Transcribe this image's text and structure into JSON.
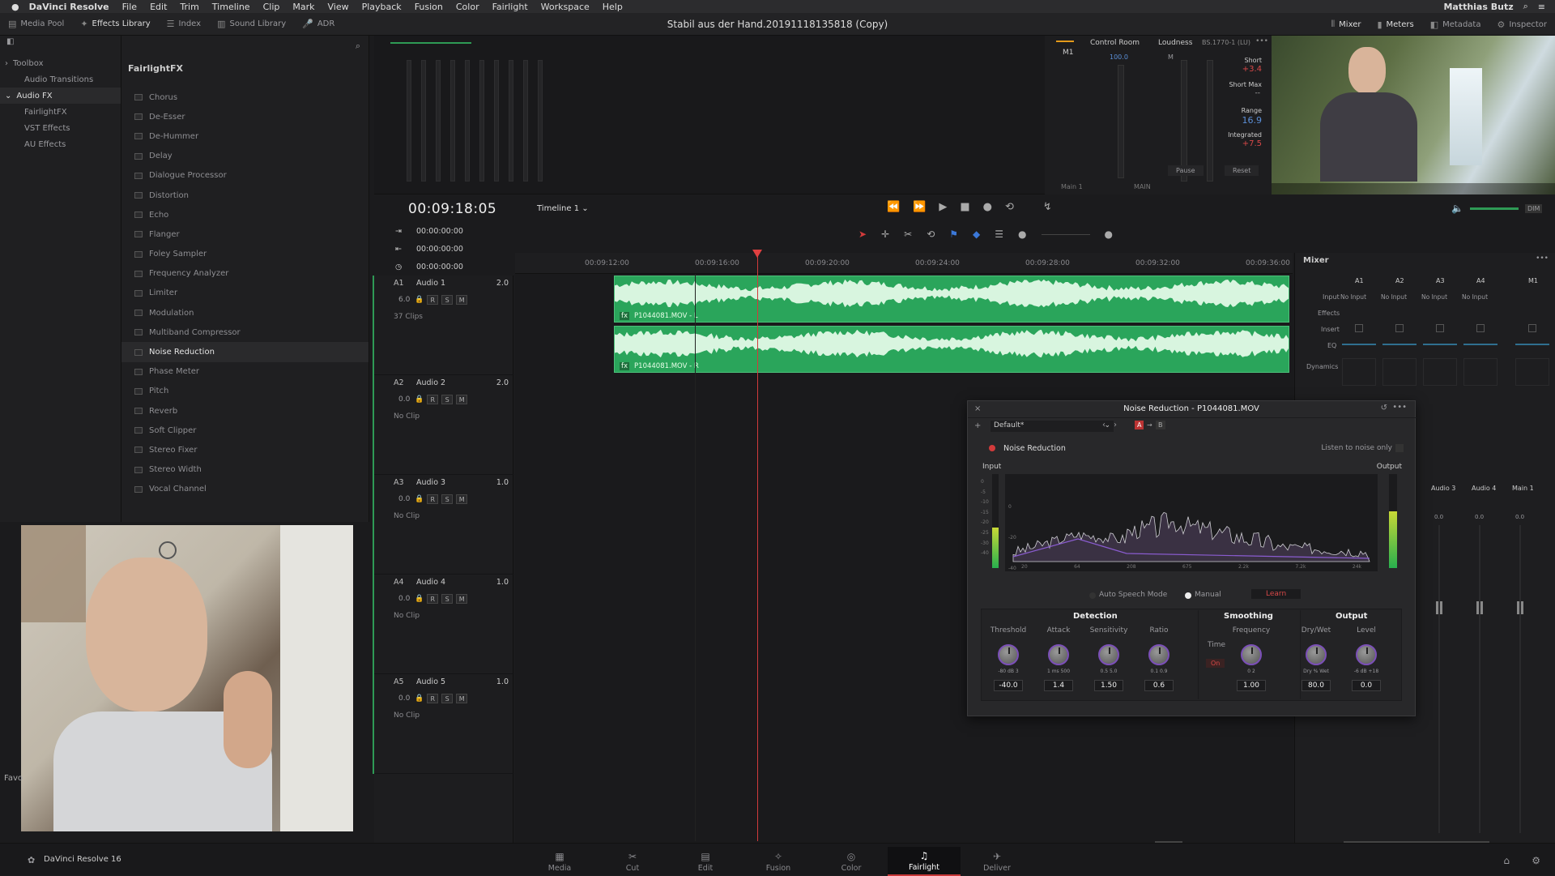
{
  "menubar": {
    "app_name": "DaVinci Resolve",
    "items": [
      "File",
      "Edit",
      "Trim",
      "Timeline",
      "Clip",
      "Mark",
      "View",
      "Playback",
      "Fusion",
      "Color",
      "Fairlight",
      "Workspace",
      "Help"
    ],
    "user": "Matthias Butz"
  },
  "toolbar": {
    "left": [
      {
        "icon": "media-pool-icon",
        "label": "Media Pool"
      },
      {
        "icon": "effects-library-icon",
        "label": "Effects Library"
      },
      {
        "icon": "index-icon",
        "label": "Index"
      },
      {
        "icon": "sound-library-icon",
        "label": "Sound Library"
      },
      {
        "icon": "adr-icon",
        "label": "ADR"
      }
    ],
    "title": "Stabil aus der Hand.20191118135818 (Copy)",
    "right": [
      {
        "icon": "mixer-icon",
        "label": "Mixer"
      },
      {
        "icon": "meters-icon",
        "label": "Meters"
      },
      {
        "icon": "metadata-icon",
        "label": "Metadata"
      },
      {
        "icon": "inspector-icon",
        "label": "Inspector"
      }
    ]
  },
  "tree": {
    "items": [
      {
        "label": "Toolbox",
        "level": 0
      },
      {
        "label": "Audio Transitions",
        "level": 1
      },
      {
        "label": "Audio FX",
        "level": 0
      },
      {
        "label": "FairlightFX",
        "level": 1
      },
      {
        "label": "VST Effects",
        "level": 1
      },
      {
        "label": "AU Effects",
        "level": 1
      }
    ]
  },
  "fxlist": {
    "title": "FairlightFX",
    "items": [
      "Chorus",
      "De-Esser",
      "De-Hummer",
      "Delay",
      "Dialogue Processor",
      "Distortion",
      "Echo",
      "Flanger",
      "Foley Sampler",
      "Frequency Analyzer",
      "Limiter",
      "Modulation",
      "Multiband Compressor",
      "Noise Reduction",
      "Phase Meter",
      "Pitch",
      "Reverb",
      "Soft Clipper",
      "Stereo Fixer",
      "Stereo Width",
      "Vocal Channel"
    ],
    "selected": "Noise Reduction"
  },
  "favorites_label": "Favo",
  "control_room": {
    "label": "Control Room",
    "m1": "M1",
    "value": "100.0",
    "loudness": "Loudness",
    "standard": "BS.1770-1 (LU)",
    "m_label": "M",
    "short_label": "Short",
    "short_value": "+3.4",
    "short_max_label": "Short Max",
    "short_max_value": "--",
    "range_label": "Range",
    "range_value": "16.9",
    "integrated_label": "Integrated",
    "integrated_value": "+7.5",
    "pause": "Pause",
    "reset": "Reset",
    "main_label": "Main 1",
    "main_out": "MAIN"
  },
  "timeline": {
    "timecode": "00:09:18:05",
    "name": "Timeline 1",
    "times": [
      "00:00:00:00",
      "00:00:00:00",
      "00:00:00:00"
    ],
    "ruler": [
      "00:09:12:00",
      "00:09:16:00",
      "00:09:20:00",
      "00:09:24:00",
      "00:09:28:00",
      "00:09:32:00",
      "00:09:36:00"
    ],
    "tracks": [
      {
        "id": "A1",
        "name": "Audio 1",
        "ch": "2.0",
        "vol": "6.0",
        "clips": "37 Clips"
      },
      {
        "id": "A2",
        "name": "Audio 2",
        "ch": "2.0",
        "vol": "0.0",
        "clips": "No Clip"
      },
      {
        "id": "A3",
        "name": "Audio 3",
        "ch": "1.0",
        "vol": "0.0",
        "clips": "No Clip"
      },
      {
        "id": "A4",
        "name": "Audio 4",
        "ch": "1.0",
        "vol": "0.0",
        "clips": "No Clip"
      },
      {
        "id": "A5",
        "name": "Audio 5",
        "ch": "1.0",
        "vol": "0.0",
        "clips": "No Clip"
      }
    ],
    "btn_r": "R",
    "btn_s": "S",
    "btn_m": "M",
    "clip_l": "P1044081.MOV - L",
    "clip_r": "P1044081.MOV - R"
  },
  "mixer": {
    "title": "Mixer",
    "channels": [
      "A1",
      "A2",
      "A3",
      "A4",
      "M1"
    ],
    "input_label": "Input",
    "input_value": "No Input",
    "effects_label": "Effects",
    "insert_label": "Insert",
    "eq_label": "EQ",
    "dynamics_label": "Dynamics",
    "bottom_channels": [
      "Audio 3",
      "Audio 4",
      "Main 1"
    ],
    "bottom_vals": [
      "0.0",
      "0.0",
      "0.0"
    ]
  },
  "plugin": {
    "title": "Noise Reduction - P1044081.MOV",
    "preset": "Default*",
    "ab": [
      "A",
      "B"
    ],
    "name": "Noise Reduction",
    "listen": "Listen to noise only",
    "input_label": "Input",
    "output_label": "Output",
    "freq_labels": [
      "20",
      "64",
      "208",
      "675",
      "2.2k",
      "7.2k",
      "24k"
    ],
    "db_scale": [
      "0",
      "-5",
      "-10",
      "-15",
      "-20",
      "-25",
      "-30",
      "-40"
    ],
    "graph_scale": [
      "0",
      "-20",
      "-40"
    ],
    "mode_auto": "Auto Speech Mode",
    "mode_manual": "Manual",
    "learn": "Learn",
    "sections": {
      "detection": "Detection",
      "smoothing": "Smoothing",
      "output": "Output"
    },
    "knobs": [
      {
        "label": "Threshold",
        "value": "-40.0",
        "scale": "-80  dB  3"
      },
      {
        "label": "Attack",
        "value": "1.4",
        "scale": "1  ms 500"
      },
      {
        "label": "Sensitivity",
        "value": "1.50",
        "scale": "0.5    5.0"
      },
      {
        "label": "Ratio",
        "value": "0.6",
        "scale": "0.1    0.9"
      },
      {
        "label": "Frequency",
        "value": "1.00",
        "scale": "0      2"
      },
      {
        "label": "Dry/Wet",
        "value": "80.0",
        "scale": "Dry  %  Wet"
      },
      {
        "label": "Level",
        "value": "0.0",
        "scale": "-6  dB +18"
      }
    ],
    "time_label": "Time",
    "time_toggle": "On"
  },
  "pages": [
    {
      "icon": "media-page-icon",
      "label": "Media"
    },
    {
      "icon": "cut-page-icon",
      "label": "Cut"
    },
    {
      "icon": "edit-page-icon",
      "label": "Edit"
    },
    {
      "icon": "fusion-page-icon",
      "label": "Fusion"
    },
    {
      "icon": "color-page-icon",
      "label": "Color"
    },
    {
      "icon": "fairlight-page-icon",
      "label": "Fairlight"
    },
    {
      "icon": "deliver-page-icon",
      "label": "Deliver"
    }
  ],
  "active_page": "Fairlight",
  "bottom_app": "DaVinci Resolve 16",
  "colors": {
    "accent": "#c83838",
    "clip": "#2aa55b",
    "knob_ring": "#7b4fb8"
  }
}
